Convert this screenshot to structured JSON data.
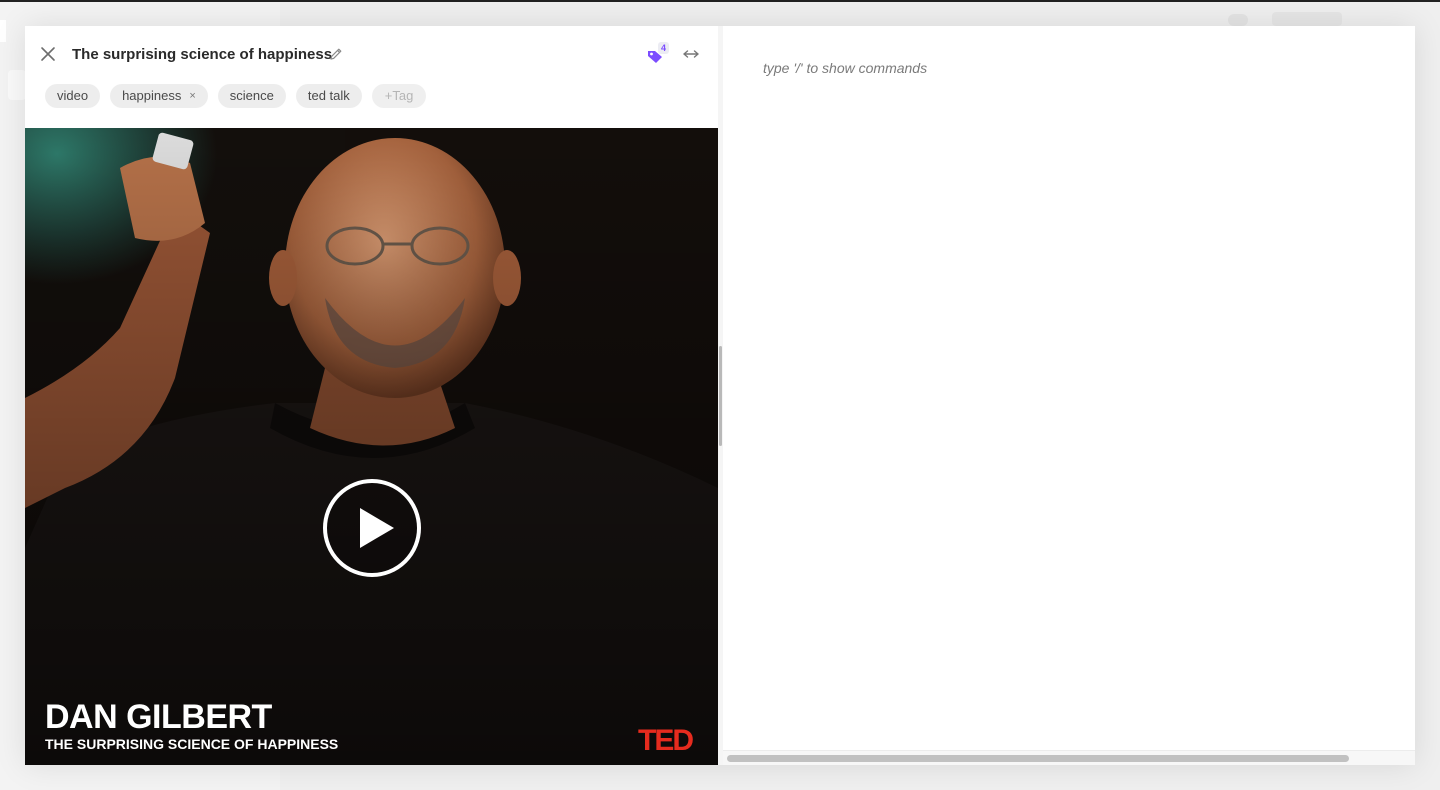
{
  "modal": {
    "title": "The surprising science of happiness",
    "tag_count": "4",
    "tags": [
      {
        "label": "video",
        "removable": false
      },
      {
        "label": "happiness",
        "removable": true
      },
      {
        "label": "science",
        "removable": false
      },
      {
        "label": "ted talk",
        "removable": false
      }
    ],
    "add_tag_label": "+Tag",
    "remove_tag_glyph": "×"
  },
  "video": {
    "speaker": "DAN GILBERT",
    "talk_title": "THE SURPRISING SCIENCE OF HAPPINESS",
    "brand": "TED",
    "brand_color": "#e62b1e"
  },
  "editor": {
    "placeholder": "type '/' to show commands"
  },
  "icons": {
    "close": "close-icon",
    "edit": "pencil-icon",
    "tag": "tag-icon",
    "expand": "expand-horizontal-icon",
    "play": "play-icon"
  },
  "colors": {
    "accent": "#7c4dff",
    "tag_bg": "#ededed"
  }
}
